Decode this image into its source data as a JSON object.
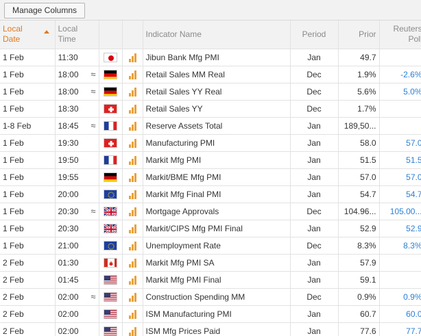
{
  "toolbar": {
    "manage_label": "Manage Columns"
  },
  "headers": {
    "local_date": [
      "Local",
      "Date"
    ],
    "local_time": [
      "Local",
      "Time"
    ],
    "indicator_name": "Indicator Name",
    "period": "Period",
    "prior": "Prior",
    "reuters_poll": [
      "Reuters",
      "Poll"
    ]
  },
  "colors": {
    "sorted_header": "#e07a1f",
    "poll_text": "#2a7fd4",
    "importance_bar": "#e8a23b"
  },
  "rows": [
    {
      "date": "1 Feb",
      "time": "11:30",
      "revised": "",
      "flag": "japan-flag-icon",
      "name": "Jibun Bank Mfg PMI",
      "period": "Jan",
      "prior": "49.7",
      "poll": ""
    },
    {
      "date": "1 Feb",
      "time": "18:00",
      "revised": "≈",
      "flag": "germany-flag-icon",
      "name": "Retail Sales MM Real",
      "period": "Dec",
      "prior": "1.9%",
      "poll": "-2.6%"
    },
    {
      "date": "1 Feb",
      "time": "18:00",
      "revised": "≈",
      "flag": "germany-flag-icon",
      "name": "Retail Sales YY Real",
      "period": "Dec",
      "prior": "5.6%",
      "poll": "5.0%"
    },
    {
      "date": "1 Feb",
      "time": "18:30",
      "revised": "",
      "flag": "switzerland-flag-icon",
      "name": "Retail Sales YY",
      "period": "Dec",
      "prior": "1.7%",
      "poll": ""
    },
    {
      "date": "1-8 Feb",
      "time": "18:45",
      "revised": "≈",
      "flag": "france-flag-icon",
      "name": "Reserve Assets Total",
      "period": "Jan",
      "prior": "189,50...",
      "poll": ""
    },
    {
      "date": "1 Feb",
      "time": "19:30",
      "revised": "",
      "flag": "switzerland-flag-icon",
      "name": "Manufacturing PMI",
      "period": "Jan",
      "prior": "58.0",
      "poll": "57.0"
    },
    {
      "date": "1 Feb",
      "time": "19:50",
      "revised": "",
      "flag": "france-flag-icon",
      "name": "Markit Mfg PMI",
      "period": "Jan",
      "prior": "51.5",
      "poll": "51.5"
    },
    {
      "date": "1 Feb",
      "time": "19:55",
      "revised": "",
      "flag": "germany-flag-icon",
      "name": "Markit/BME Mfg PMI",
      "period": "Jan",
      "prior": "57.0",
      "poll": "57.0"
    },
    {
      "date": "1 Feb",
      "time": "20:00",
      "revised": "",
      "flag": "eu-flag-icon",
      "name": "Markit Mfg Final PMI",
      "period": "Jan",
      "prior": "54.7",
      "poll": "54.7"
    },
    {
      "date": "1 Feb",
      "time": "20:30",
      "revised": "≈",
      "flag": "uk-flag-icon",
      "name": "Mortgage Approvals",
      "period": "Dec",
      "prior": "104.96...",
      "poll": "105.00..."
    },
    {
      "date": "1 Feb",
      "time": "20:30",
      "revised": "",
      "flag": "uk-flag-icon",
      "name": "Markit/CIPS Mfg PMI Final",
      "period": "Jan",
      "prior": "52.9",
      "poll": "52.9"
    },
    {
      "date": "1 Feb",
      "time": "21:00",
      "revised": "",
      "flag": "eu-flag-icon",
      "name": "Unemployment Rate",
      "period": "Dec",
      "prior": "8.3%",
      "poll": "8.3%"
    },
    {
      "date": "2 Feb",
      "time": "01:30",
      "revised": "",
      "flag": "canada-flag-icon",
      "name": "Markit Mfg PMI SA",
      "period": "Jan",
      "prior": "57.9",
      "poll": ""
    },
    {
      "date": "2 Feb",
      "time": "01:45",
      "revised": "",
      "flag": "usa-flag-icon",
      "name": "Markit Mfg PMI Final",
      "period": "Jan",
      "prior": "59.1",
      "poll": ""
    },
    {
      "date": "2 Feb",
      "time": "02:00",
      "revised": "≈",
      "flag": "usa-flag-icon",
      "name": "Construction Spending MM",
      "period": "Dec",
      "prior": "0.9%",
      "poll": "0.9%"
    },
    {
      "date": "2 Feb",
      "time": "02:00",
      "revised": "",
      "flag": "usa-flag-icon",
      "name": "ISM Manufacturing PMI",
      "period": "Jan",
      "prior": "60.7",
      "poll": "60.0"
    },
    {
      "date": "2 Feb",
      "time": "02:00",
      "revised": "",
      "flag": "usa-flag-icon",
      "name": "ISM Mfg Prices Paid",
      "period": "Jan",
      "prior": "77.6",
      "poll": "77.7"
    }
  ]
}
